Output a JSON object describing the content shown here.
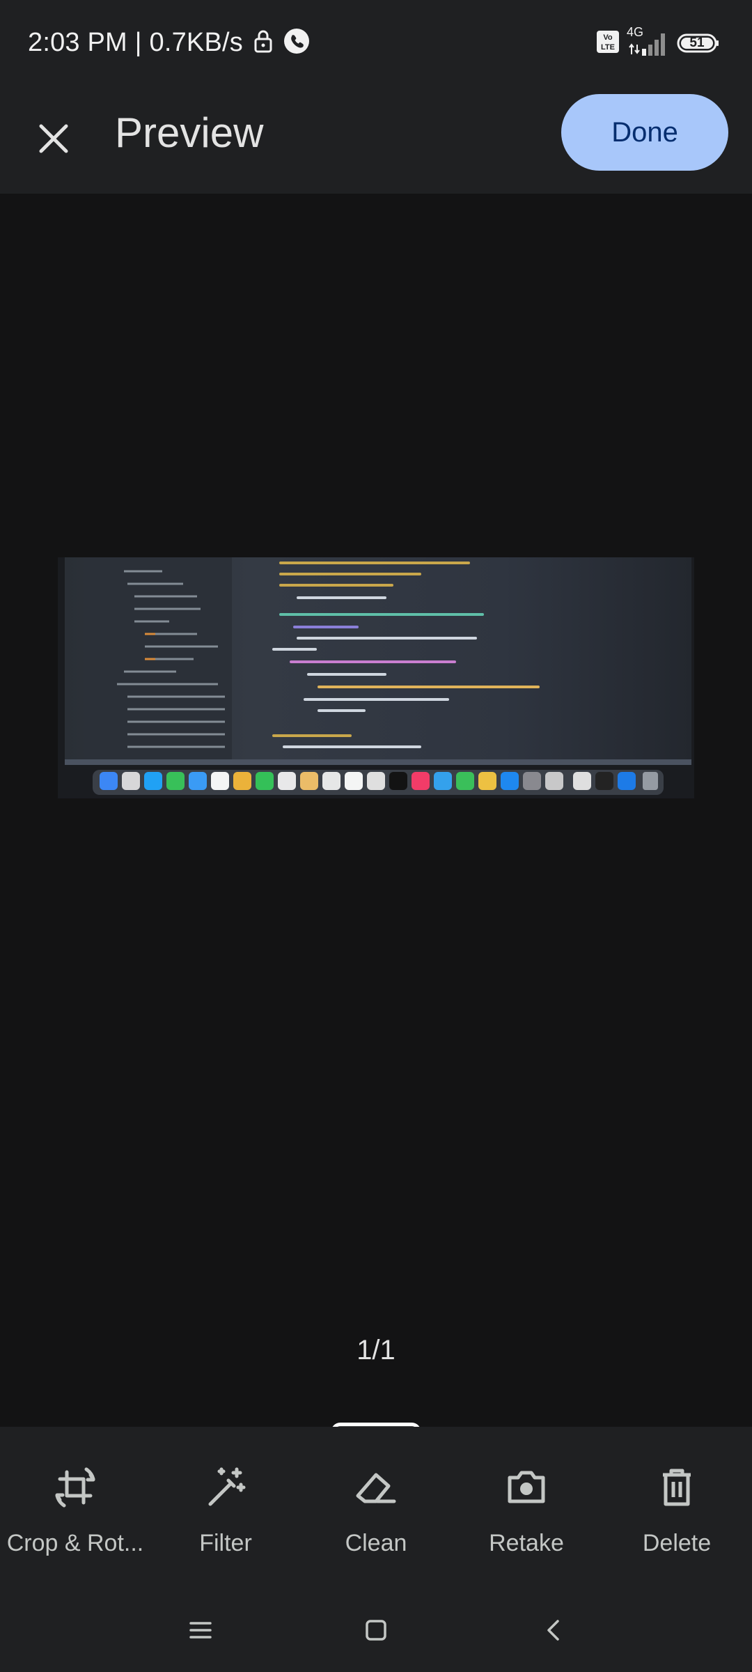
{
  "status_bar": {
    "time_speed": "2:03 PM | 0.7KB/s",
    "network": "4G",
    "volte": "Vo LTE",
    "battery": "51",
    "icons": [
      "lock-icon",
      "phone-icon",
      "volte-icon",
      "signal-icon",
      "battery-icon"
    ]
  },
  "app_bar": {
    "title": "Preview",
    "done_label": "Done",
    "close_icon": "close-icon"
  },
  "page_counter": "1/1",
  "toolbar": {
    "crop_label": "Crop & Rot...",
    "filter_label": "Filter",
    "clean_label": "Clean",
    "retake_label": "Retake",
    "delete_label": "Delete"
  },
  "colors": {
    "accent": "#a8c7fa",
    "on_accent": "#062e6f",
    "surface": "#1f2022",
    "background": "#131314"
  }
}
